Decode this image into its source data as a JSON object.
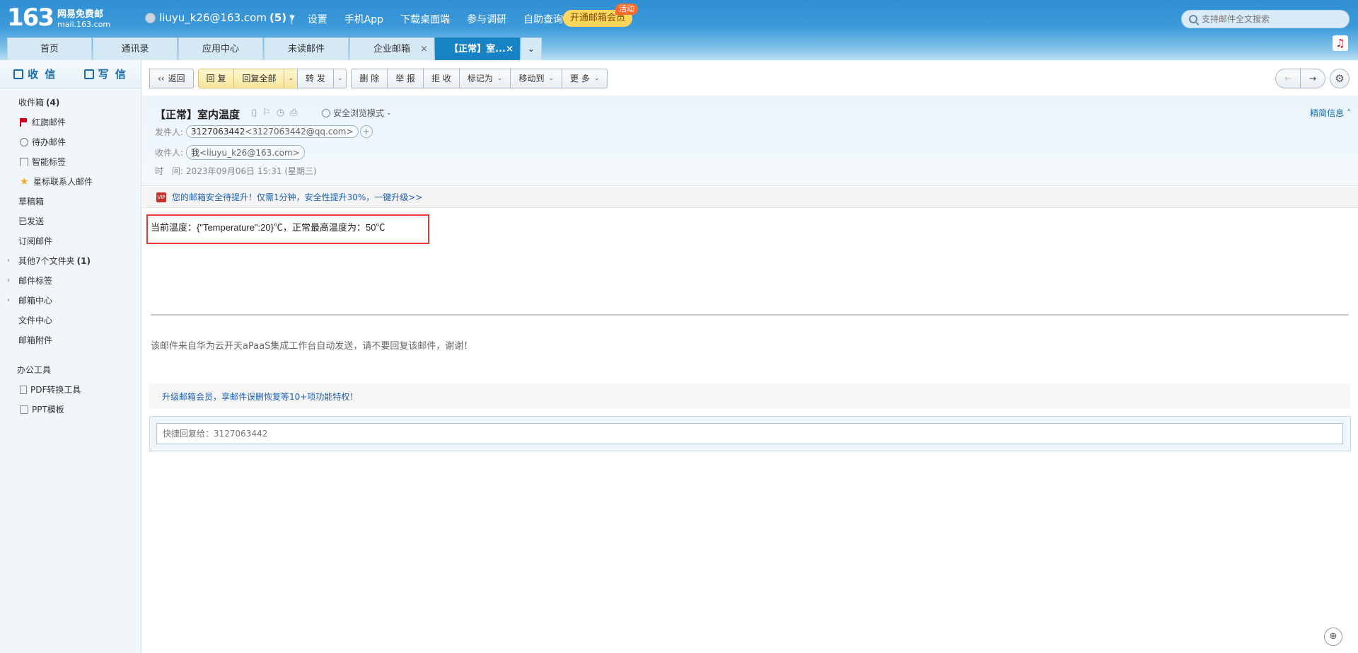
{
  "header": {
    "logo_number": "163",
    "logo_title": "网易免费邮",
    "logo_domain": "mail.163.com",
    "account": "liuyu_k26@163.com",
    "account_count": "(5)",
    "nav": [
      "设置",
      "手机App",
      "下载桌面端",
      "参与调研",
      "自助查询"
    ],
    "vip_button": "开通邮箱会员",
    "vip_badge": "活动",
    "search_placeholder": "支持邮件全文搜索"
  },
  "tabs": [
    {
      "label": "首页"
    },
    {
      "label": "通讯录"
    },
    {
      "label": "应用中心"
    },
    {
      "label": "未读邮件"
    },
    {
      "label": "企业邮箱"
    },
    {
      "label": "【正常】室..."
    }
  ],
  "sidebar": {
    "receive": "收 信",
    "write": "写 信",
    "items": [
      {
        "label": "收件箱",
        "count": "(4)"
      },
      {
        "label": "红旗邮件"
      },
      {
        "label": "待办邮件"
      },
      {
        "label": "智能标签"
      },
      {
        "label": "星标联系人邮件"
      },
      {
        "label": "草稿箱"
      },
      {
        "label": "已发送"
      },
      {
        "label": "订阅邮件"
      },
      {
        "label": "其他7个文件夹",
        "count": "(1)"
      },
      {
        "label": "邮件标签"
      },
      {
        "label": "邮箱中心"
      },
      {
        "label": "文件中心"
      },
      {
        "label": "邮箱附件"
      }
    ],
    "office_group": "办公工具",
    "office_items": [
      "PDF转换工具",
      "PPT模板"
    ]
  },
  "toolbar": {
    "back": "返回",
    "reply": "回 复",
    "reply_all": "回复全部",
    "forward": "转 发",
    "delete": "删 除",
    "report": "举 报",
    "reject": "拒 收",
    "mark_as": "标记为",
    "move_to": "移动到",
    "more": "更 多"
  },
  "mail": {
    "subject": "【正常】室内温度",
    "safe_mode": "安全浏览模式",
    "brief_info": "精简信息",
    "from_label": "发件人:",
    "from_name": "3127063442",
    "from_addr": "<3127063442@qq.com>",
    "to_label": "收件人:",
    "to_name": "我",
    "to_addr": "<liuyu_k26@163.com>",
    "time_label": "时　间:",
    "time_value": "2023年09月06日 15:31 (星期三)",
    "vip_notice": "您的邮箱安全待提升！仅需1分钟，安全性提升30%，一键升级>>",
    "body": "当前温度：{\"Temperature\":20}℃，正常最高温度为：50℃",
    "auto_note": "该邮件来自华为云开天aPaaS集成工作台自动发送，请不要回复该邮件，谢谢！",
    "upgrade_bar": "升级邮箱会员，享邮件误删恢复等10+项功能特权！",
    "quick_reply_placeholder": "快捷回复给：3127063442"
  }
}
